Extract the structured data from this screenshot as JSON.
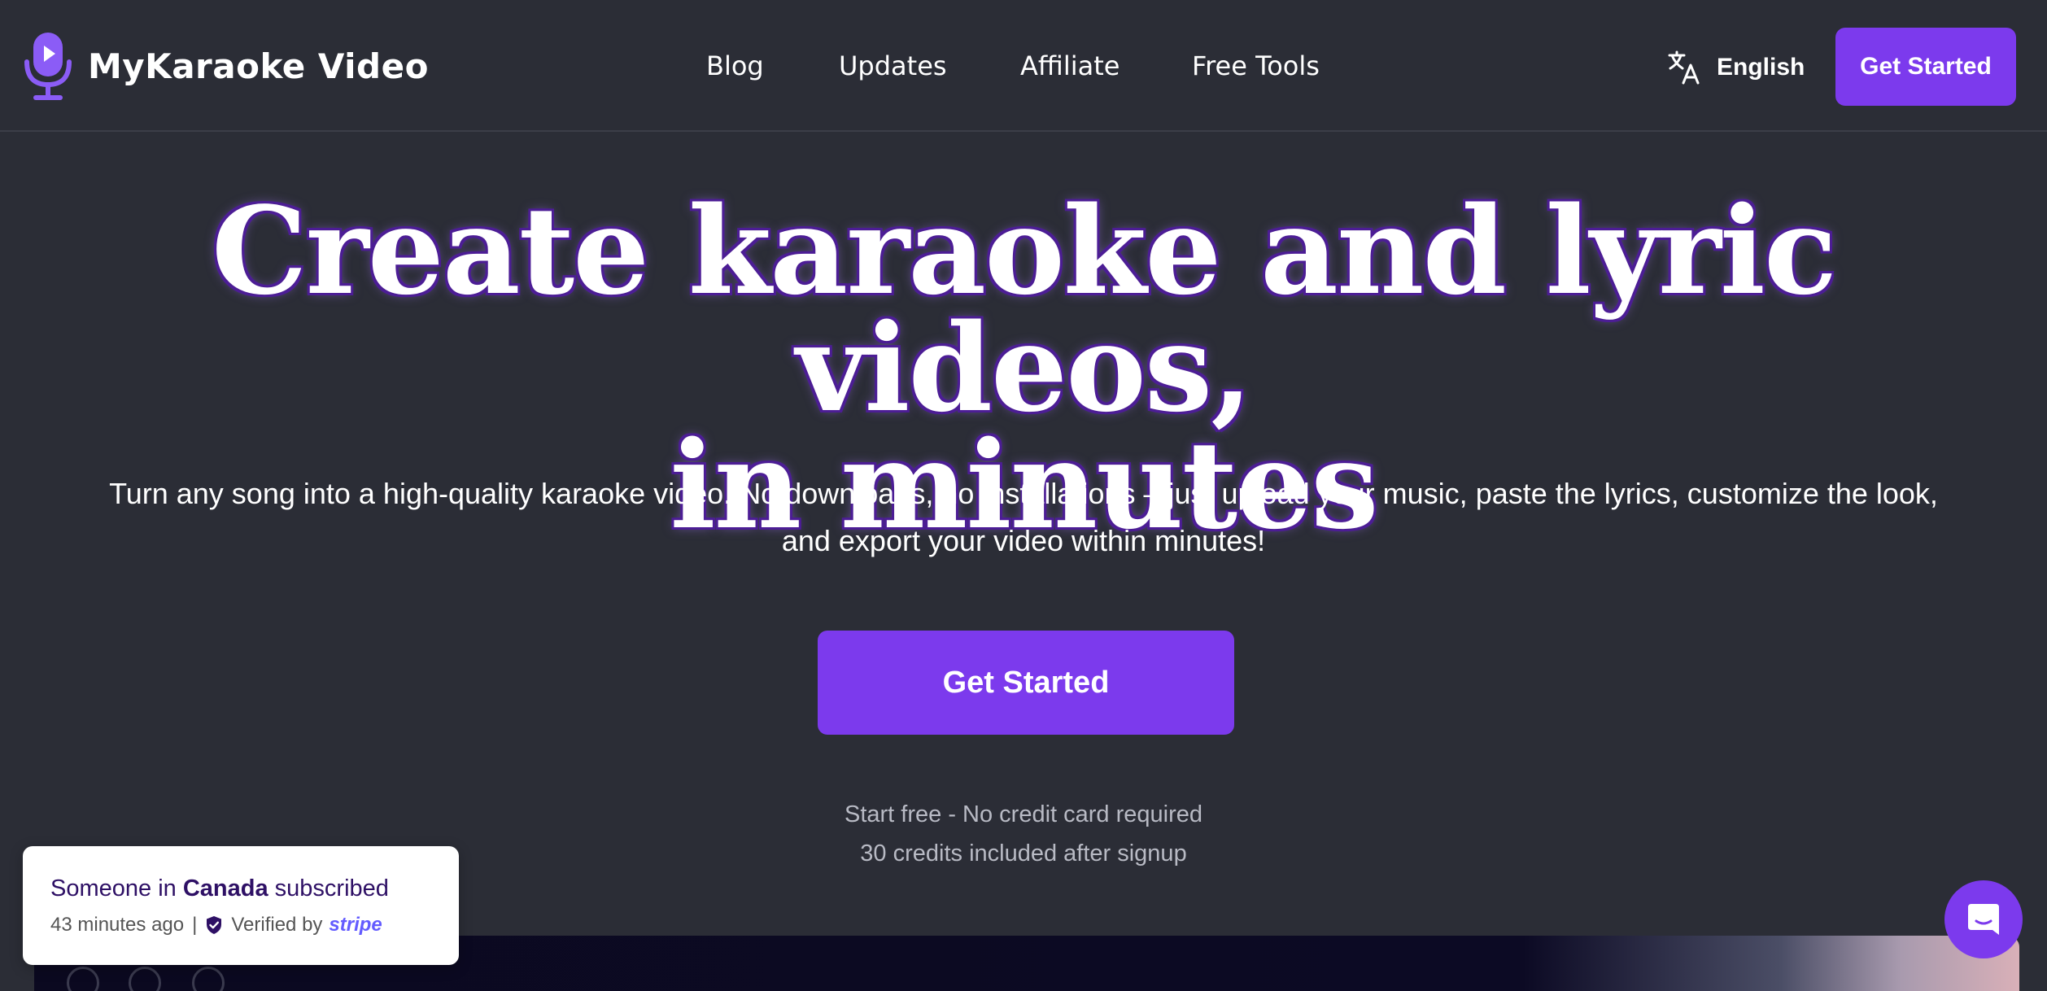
{
  "header": {
    "logo_text": "MyKaraoke Video",
    "nav": {
      "blog": "Blog",
      "updates": "Updates",
      "affiliate": "Affiliate",
      "free_tools": "Free Tools"
    },
    "language": "English",
    "cta_label": "Get Started",
    "icons": {
      "logo": "microphone-play-icon",
      "language": "translate-icon"
    }
  },
  "hero": {
    "title_line1": "Create karaoke and lyric videos,",
    "title_line2": "in minutes",
    "subtitle_line1": "Turn any song into a high-quality karaoke video. No downloads, no installations – just upload your music, paste the lyrics, customize the look,",
    "subtitle_line2": "and export your video within minutes!",
    "cta_label": "Get Started",
    "note_line1": "Start free - No credit card required",
    "note_line2": "30 credits included after signup"
  },
  "toast": {
    "prefix": "Someone in ",
    "location": "Canada",
    "suffix": " subscribed",
    "time": "43 minutes ago",
    "separator": "|",
    "verified_label": "Verified by",
    "verified_brand": "stripe",
    "icon": "shield-check-icon"
  },
  "chat": {
    "icon": "chat-bubble-icon"
  },
  "colors": {
    "background": "#2b2d36",
    "accent": "#7c3aed",
    "title_outline": "#4c1d95",
    "muted_text": "#b8bac4",
    "stripe_brand": "#635bff"
  }
}
